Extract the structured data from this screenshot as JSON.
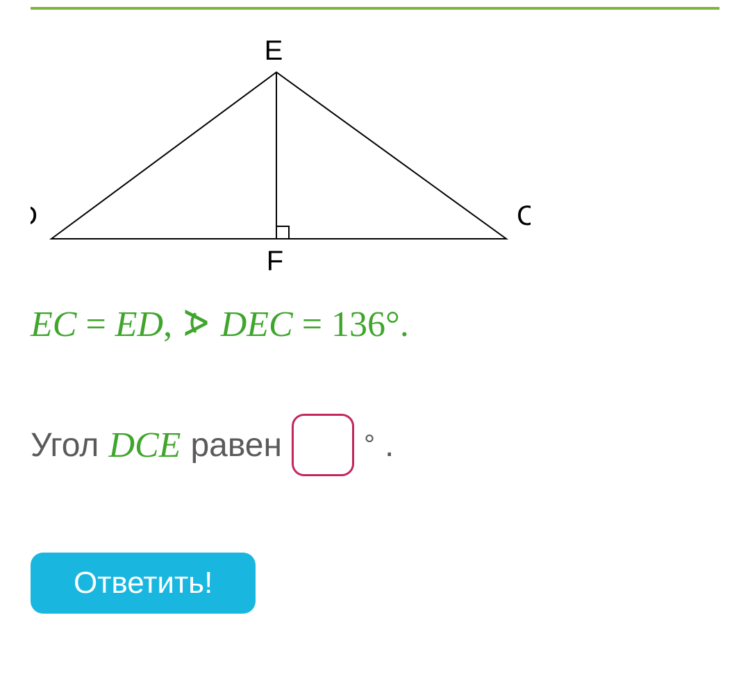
{
  "figure": {
    "labels": {
      "E": "E",
      "D": "D",
      "C": "C",
      "F": "F"
    }
  },
  "given": {
    "eq1_lhs": "EC",
    "eq1_rhs": "ED",
    "angle_label": "DEC",
    "angle_value": "136"
  },
  "question": {
    "word_angle": "Угол",
    "var": "DCE",
    "word_equals": "равен",
    "answer_value": "",
    "deg": "°",
    "period": "."
  },
  "buttons": {
    "submit": "Ответить!"
  }
}
